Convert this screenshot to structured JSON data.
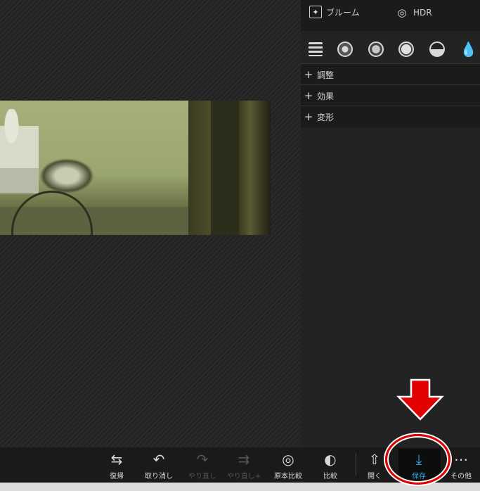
{
  "panel": {
    "tools": [
      {
        "label": "ブルーム",
        "icon": "sparkle-icon"
      },
      {
        "label": "HDR",
        "icon": "hdr-icon"
      }
    ],
    "filter_icons": [
      "histogram-icon",
      "filter-circle-1-icon",
      "filter-circle-2-icon",
      "filter-circle-3-icon",
      "half-circle-icon",
      "droplet-icon"
    ],
    "sections": [
      {
        "label": "調整"
      },
      {
        "label": "効果"
      },
      {
        "label": "変形"
      }
    ]
  },
  "toolbar": {
    "items": [
      {
        "label": "復帰",
        "icon": "revert-icon",
        "state": "enabled"
      },
      {
        "label": "取り消し",
        "icon": "undo-icon",
        "state": "enabled"
      },
      {
        "label": "やり直し",
        "icon": "redo-icon",
        "state": "disabled"
      },
      {
        "label": "やり直し+",
        "icon": "redo-all-icon",
        "state": "disabled"
      },
      {
        "label": "原本比較",
        "icon": "compare-original-icon",
        "state": "enabled"
      },
      {
        "label": "比較",
        "icon": "compare-icon",
        "state": "enabled"
      },
      {
        "label": "開く",
        "icon": "upload-icon",
        "state": "enabled"
      },
      {
        "label": "保存",
        "icon": "download-icon",
        "state": "active"
      },
      {
        "label": "その他",
        "icon": "more-icon",
        "state": "enabled"
      }
    ]
  },
  "annotation": {
    "color": "#e20000"
  }
}
